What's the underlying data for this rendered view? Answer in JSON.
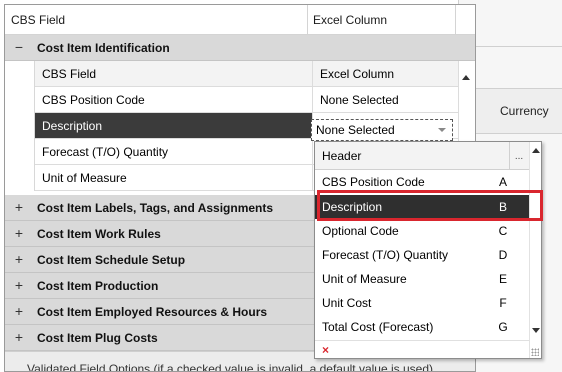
{
  "background": {
    "currency_label": "Currency"
  },
  "grid": {
    "col_field": "CBS Field",
    "col_excel": "Excel Column",
    "groups": [
      {
        "label": "Cost Item Identification",
        "toggle": "−"
      },
      {
        "label": "Cost Item Labels, Tags, and Assignments",
        "toggle": "+"
      },
      {
        "label": "Cost Item Work Rules",
        "toggle": "+"
      },
      {
        "label": "Cost Item Schedule Setup",
        "toggle": "+"
      },
      {
        "label": "Cost Item Production",
        "toggle": "+"
      },
      {
        "label": "Cost Item Employed Resources & Hours",
        "toggle": "+"
      },
      {
        "label": "Cost Item Plug Costs",
        "toggle": "+"
      }
    ],
    "sub_header": {
      "field": "CBS Field",
      "excel": "Excel Column"
    },
    "rows": [
      {
        "field": "CBS Position Code",
        "excel": "None Selected"
      },
      {
        "field": "Description",
        "excel": "None Selected"
      },
      {
        "field": "Forecast (T/O) Quantity",
        "excel": ""
      },
      {
        "field": "Unit of Measure",
        "excel": ""
      }
    ],
    "footer_text": "Validated Field Options (if a checked value is invalid, a default value is used)"
  },
  "dropdown": {
    "header": "Header",
    "more": "...",
    "items": [
      {
        "name": "CBS Position Code",
        "key": "A"
      },
      {
        "name": "Description",
        "key": "B"
      },
      {
        "name": "Optional Code",
        "key": "C"
      },
      {
        "name": "Forecast (T/O) Quantity",
        "key": "D"
      },
      {
        "name": "Unit of Measure",
        "key": "E"
      },
      {
        "name": "Unit Cost",
        "key": "F"
      },
      {
        "name": "Total Cost (Forecast)",
        "key": "G"
      }
    ],
    "clear": "×",
    "selected_index": 1
  },
  "colors": {
    "selection": "#2f2f2f",
    "highlight": "#d9262e",
    "group_bg": "#d9d9d9"
  }
}
